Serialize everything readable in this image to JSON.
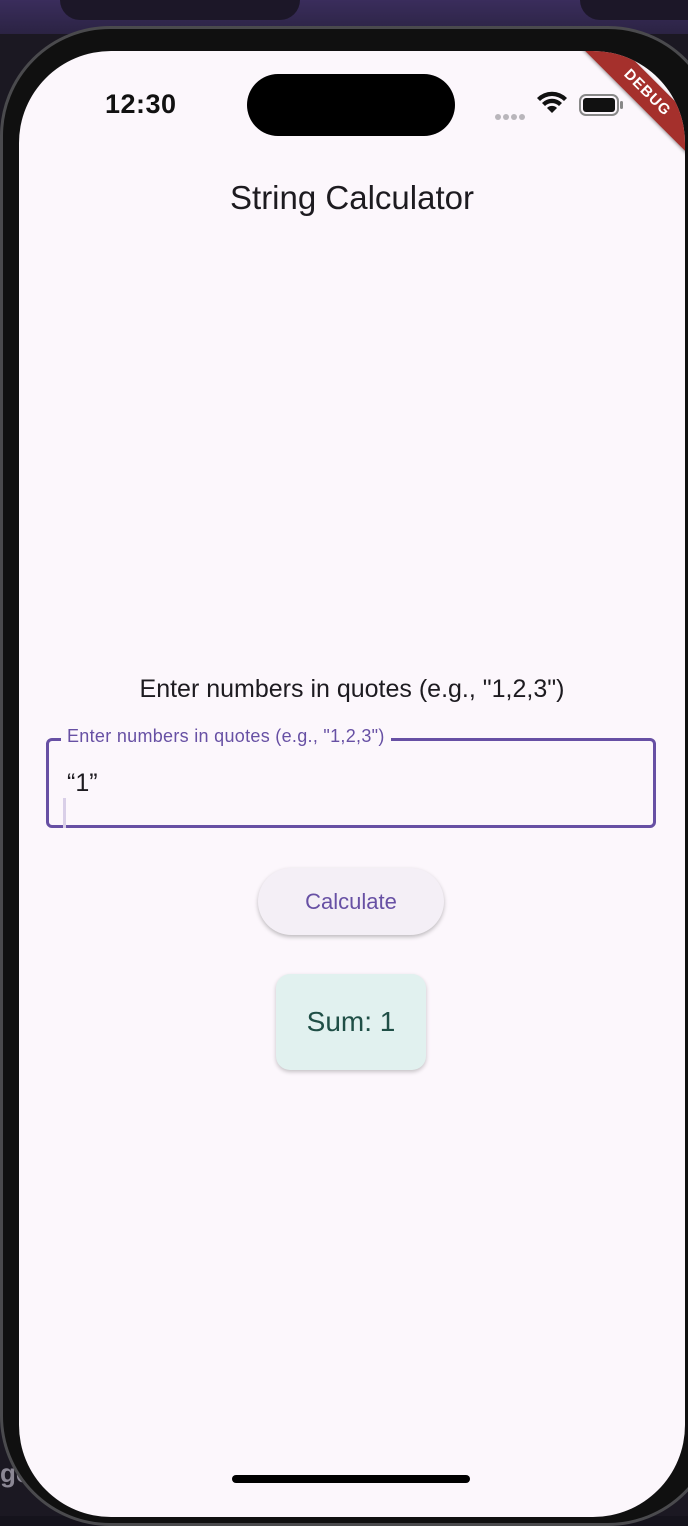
{
  "status_bar": {
    "time": "12:30",
    "debug_banner": "DEBUG"
  },
  "app": {
    "title": "String Calculator",
    "prompt": "Enter numbers in quotes (e.g., \"1,2,3\")",
    "input": {
      "label": "Enter numbers in quotes (e.g., \"1,2,3\")",
      "value": "“1”"
    },
    "calculate_label": "Calculate",
    "result_text": "Sum: 1"
  },
  "background": {
    "side_text": "ge"
  },
  "colors": {
    "primary": "#6750a4",
    "screen_bg": "#fcf7fc",
    "result_bg": "#e1f1ef",
    "result_text": "#1f4f46",
    "debug_ribbon": "#a5302c"
  }
}
